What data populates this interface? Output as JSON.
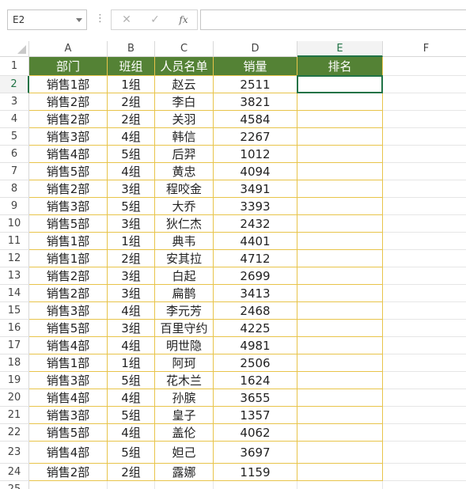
{
  "formula_bar": {
    "name_box": "E2",
    "more_icon": "⋮",
    "cancel_icon": "✕",
    "enter_icon": "✓",
    "fx_label": "fx",
    "formula": ""
  },
  "columns": [
    "A",
    "B",
    "C",
    "D",
    "E",
    "F"
  ],
  "row_numbers": [
    "1",
    "2",
    "3",
    "4",
    "5",
    "6",
    "7",
    "8",
    "9",
    "10",
    "11",
    "12",
    "13",
    "14",
    "15",
    "16",
    "17",
    "18",
    "19",
    "20",
    "21",
    "22",
    "23",
    "24",
    "25"
  ],
  "table": {
    "headers": [
      "部门",
      "班组",
      "人员名单",
      "销量",
      "排名"
    ],
    "rows": [
      [
        "销售1部",
        "1组",
        "赵云",
        "2511",
        ""
      ],
      [
        "销售2部",
        "2组",
        "李白",
        "3821",
        ""
      ],
      [
        "销售2部",
        "2组",
        "关羽",
        "4584",
        ""
      ],
      [
        "销售3部",
        "4组",
        "韩信",
        "2267",
        ""
      ],
      [
        "销售4部",
        "5组",
        "后羿",
        "1012",
        ""
      ],
      [
        "销售5部",
        "4组",
        "黄忠",
        "4094",
        ""
      ],
      [
        "销售2部",
        "3组",
        "程咬金",
        "3491",
        ""
      ],
      [
        "销售3部",
        "5组",
        "大乔",
        "3393",
        ""
      ],
      [
        "销售5部",
        "3组",
        "狄仁杰",
        "2432",
        ""
      ],
      [
        "销售1部",
        "1组",
        "典韦",
        "4401",
        ""
      ],
      [
        "销售1部",
        "2组",
        "安其拉",
        "4712",
        ""
      ],
      [
        "销售2部",
        "3组",
        "白起",
        "2699",
        ""
      ],
      [
        "销售2部",
        "3组",
        "扁鹊",
        "3413",
        ""
      ],
      [
        "销售3部",
        "4组",
        "李元芳",
        "2468",
        ""
      ],
      [
        "销售5部",
        "3组",
        "百里守约",
        "4225",
        ""
      ],
      [
        "销售4部",
        "4组",
        "明世隐",
        "4981",
        ""
      ],
      [
        "销售1部",
        "1组",
        "阿珂",
        "2506",
        ""
      ],
      [
        "销售3部",
        "5组",
        "花木兰",
        "1624",
        ""
      ],
      [
        "销售4部",
        "4组",
        "孙膑",
        "3655",
        ""
      ],
      [
        "销售3部",
        "5组",
        "皇子",
        "1357",
        ""
      ],
      [
        "销售5部",
        "4组",
        "盖伦",
        "4062",
        ""
      ],
      [
        "销售4部",
        "5组",
        "妲己",
        "3697",
        ""
      ],
      [
        "销售2部",
        "2组",
        "露娜",
        "1159",
        ""
      ]
    ]
  },
  "colors": {
    "header_fill": "#548235",
    "header_text": "#ffffff",
    "table_border": "#e8c44a",
    "selection": "#217346"
  },
  "selection": {
    "cell": "E2"
  }
}
